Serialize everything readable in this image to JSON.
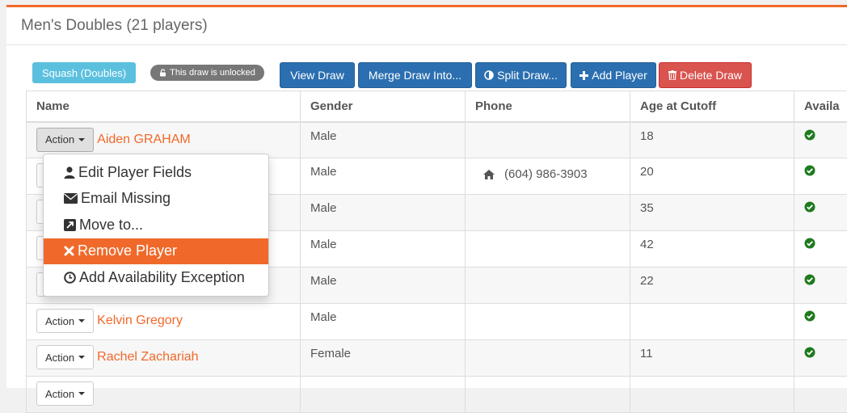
{
  "panel": {
    "title": "Men's Doubles (21 players)"
  },
  "tags": {
    "sport": "Squash (Doubles)",
    "lock": "This draw is unlocked"
  },
  "toolbar": {
    "view_draw": "View Draw",
    "merge_draw": "Merge Draw Into...",
    "split_draw": "Split Draw...",
    "add_player": "Add Player",
    "delete_draw": "Delete Draw"
  },
  "table": {
    "headers": [
      "Name",
      "Gender",
      "Phone",
      "Age at Cutoff",
      "Availa"
    ],
    "action_label": "Action",
    "rows": [
      {
        "name": "Aiden GRAHAM",
        "gender": "Male",
        "phone": "",
        "age": "18"
      },
      {
        "name": "",
        "gender": "Male",
        "phone": "(604) 986-3903",
        "age": "20"
      },
      {
        "name": "",
        "gender": "Male",
        "phone": "",
        "age": "35"
      },
      {
        "name": "",
        "gender": "Male",
        "phone": "",
        "age": "42"
      },
      {
        "name": "",
        "gender": "Male",
        "phone": "",
        "age": "22"
      },
      {
        "name": "Kelvin Gregory",
        "gender": "Male",
        "phone": "",
        "age": ""
      },
      {
        "name": "Rachel Zachariah",
        "gender": "Female",
        "phone": "",
        "age": "11"
      }
    ]
  },
  "dropdown": {
    "items": [
      {
        "label": "Edit Player Fields",
        "icon": "user-icon"
      },
      {
        "label": "Email Missing",
        "icon": "envelope-icon"
      },
      {
        "label": "Move to...",
        "icon": "external-link-icon"
      },
      {
        "label": "Remove Player",
        "icon": "times-icon"
      },
      {
        "label": "Add Availability Exception",
        "icon": "clock-icon"
      }
    ]
  },
  "colors": {
    "accent": "#f0692a",
    "primary": "#2b6fb0",
    "danger": "#d9534f",
    "info": "#5bc0de",
    "success": "#2e8b2e"
  }
}
